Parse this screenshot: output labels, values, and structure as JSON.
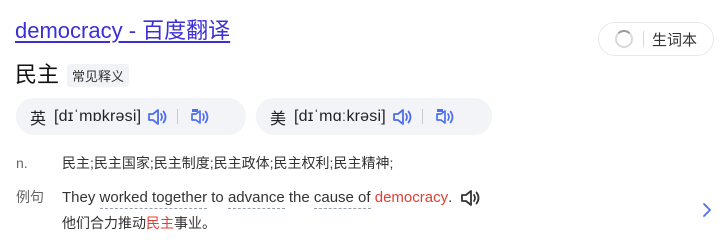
{
  "title": "democracy - 百度翻译",
  "vocab_button": {
    "label": "生词本"
  },
  "headword": "民主",
  "tag": "常见释义",
  "pronunciations": [
    {
      "region": "英",
      "phonetic": "[dɪˈmɒkrəsi]"
    },
    {
      "region": "美",
      "phonetic": "[dɪˈmɑːkrəsi]"
    }
  ],
  "definition": {
    "pos": "n.",
    "text": "民主;民主国家;民主制度;民主政体;民主权利;民主精神;"
  },
  "example": {
    "label": "例句",
    "en": {
      "part1": "They ",
      "phrase1": "worked together",
      "part2": " to ",
      "phrase2": "advance",
      "part3": " the ",
      "phrase3": "cause of",
      "part4": " ",
      "highlight": "democracy",
      "end": "."
    },
    "zh": {
      "before": "他们合力推动",
      "highlight": "民主",
      "after": "事业。"
    }
  },
  "colors": {
    "link": "#3b2fd6",
    "speaker": "#4e6ef2",
    "highlight": "#e33e33",
    "pill_bg": "#f3f4f8"
  },
  "icons": {
    "spinner": "loading-spinner-icon",
    "speaker": "speaker-icon",
    "slow_speaker": "slow-speaker-icon",
    "next": "chevron-right-icon"
  }
}
